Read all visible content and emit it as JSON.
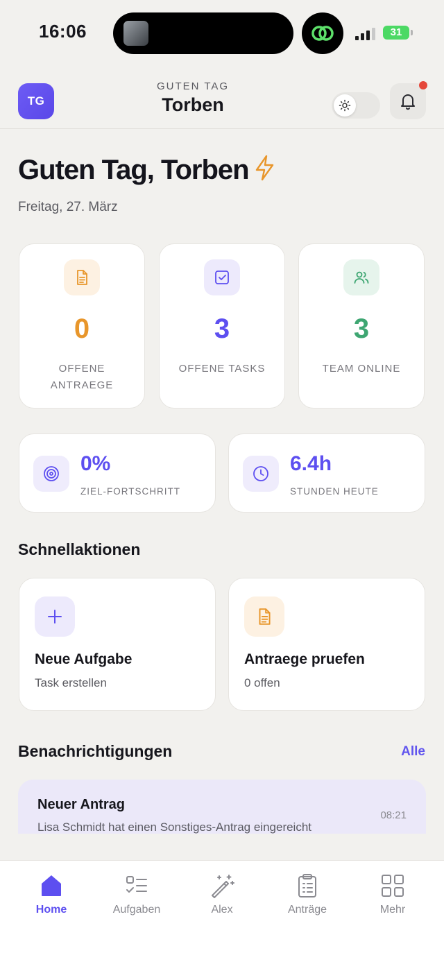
{
  "status_bar": {
    "time": "16:06",
    "battery": "31"
  },
  "header": {
    "avatar_initials": "TG",
    "greeting_small": "GUTEN TAG",
    "name": "Torben"
  },
  "hero": {
    "title": "Guten Tag, Torben",
    "date": "Freitag, 27. März"
  },
  "stats": [
    {
      "value": "0",
      "label": "OFFENE ANTRAEGE",
      "icon": "document-icon",
      "color": "#e8962b"
    },
    {
      "value": "3",
      "label": "OFFENE TASKS",
      "icon": "checkbox-icon",
      "color": "#5d4ff0"
    },
    {
      "value": "3",
      "label": "TEAM ONLINE",
      "icon": "users-icon",
      "color": "#3ea672"
    }
  ],
  "wide_stats": [
    {
      "value": "0%",
      "label": "ZIEL-FORTSCHRITT",
      "icon": "target-icon"
    },
    {
      "value": "6.4h",
      "label": "STUNDEN HEUTE",
      "icon": "clock-icon"
    }
  ],
  "quick_actions": {
    "title": "Schnellaktionen",
    "items": [
      {
        "title": "Neue Aufgabe",
        "subtitle": "Task erstellen",
        "icon": "plus-icon"
      },
      {
        "title": "Antraege pruefen",
        "subtitle": "0 offen",
        "icon": "document-icon"
      }
    ]
  },
  "notifications": {
    "title": "Benachrichtigungen",
    "see_all": "Alle",
    "items": [
      {
        "title": "Neuer Antrag",
        "text": "Lisa Schmidt hat einen Sonstiges-Antrag eingereicht",
        "time": "08:21"
      }
    ]
  },
  "bottom_nav": [
    {
      "label": "Home",
      "icon": "home-icon",
      "active": true
    },
    {
      "label": "Aufgaben",
      "icon": "tasks-list-icon",
      "active": false
    },
    {
      "label": "Alex",
      "icon": "magic-wand-icon",
      "active": false
    },
    {
      "label": "Anträge",
      "icon": "clipboard-icon",
      "active": false
    },
    {
      "label": "Mehr",
      "icon": "grid-icon",
      "active": false
    }
  ],
  "colors": {
    "accent": "#5d4ff0",
    "orange": "#e8962b",
    "green": "#3ea672",
    "background": "#f2f1ee"
  }
}
